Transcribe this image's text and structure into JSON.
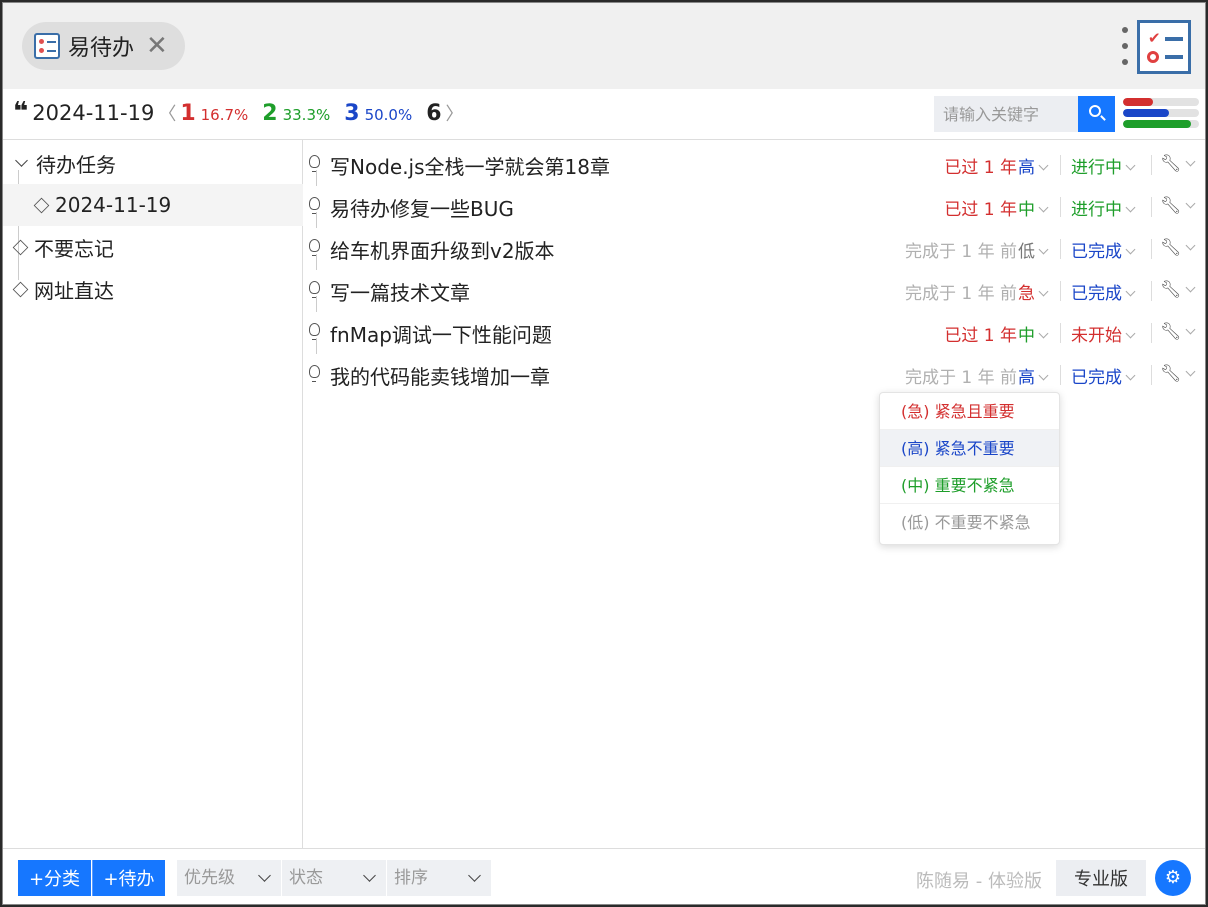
{
  "app": {
    "tab_title": "易待办",
    "logo_icon": "checklist-logo-icon"
  },
  "stats": {
    "date": "2024-11-19",
    "red": {
      "count": "1",
      "pct": "16.7%"
    },
    "green": {
      "count": "2",
      "pct": "33.3%"
    },
    "blue": {
      "count": "3",
      "pct": "50.0%"
    },
    "total": "6",
    "bars": [
      {
        "color": "#d32f2f",
        "fraction": 0.4
      },
      {
        "color": "#1a46c8",
        "fraction": 0.6
      },
      {
        "color": "#1e9e2a",
        "fraction": 0.9
      }
    ]
  },
  "search": {
    "placeholder": "请输入关键字"
  },
  "sidebar": {
    "items": [
      {
        "label": "待办任务"
      },
      {
        "label": "2024-11-19"
      },
      {
        "label": "不要忘记"
      },
      {
        "label": "网址直达"
      }
    ]
  },
  "tasks": [
    {
      "title": "写Node.js全栈一学就会第18章",
      "time": "已过 1 年",
      "priority": "高",
      "status": "进行中"
    },
    {
      "title": "易待办修复一些BUG",
      "time": "已过 1 年",
      "priority": "中",
      "status": "进行中"
    },
    {
      "title": "给车机界面升级到v2版本",
      "time": "完成于 1 年 前",
      "priority": "低",
      "status": "已完成"
    },
    {
      "title": "写一篇技术文章",
      "time": "完成于 1 年 前",
      "priority": "急",
      "status": "已完成"
    },
    {
      "title": "fnMap调试一下性能问题",
      "time": "已过 1 年",
      "priority": "中",
      "status": "未开始"
    },
    {
      "title": "我的代码能卖钱增加一章",
      "time": "完成于 1 年 前",
      "priority": "高",
      "status": "已完成"
    }
  ],
  "priority_menu": [
    "(急) 紧急且重要",
    "(高) 紧急不重要",
    "(中) 重要不紧急",
    "(低) 不重要不紧急"
  ],
  "footer": {
    "add_category": "+分类",
    "add_todo": "+待办",
    "filter_priority": "优先级",
    "filter_status": "状态",
    "sort": "排序",
    "author": "陈随易 - 体验版",
    "pro": "专业版"
  }
}
